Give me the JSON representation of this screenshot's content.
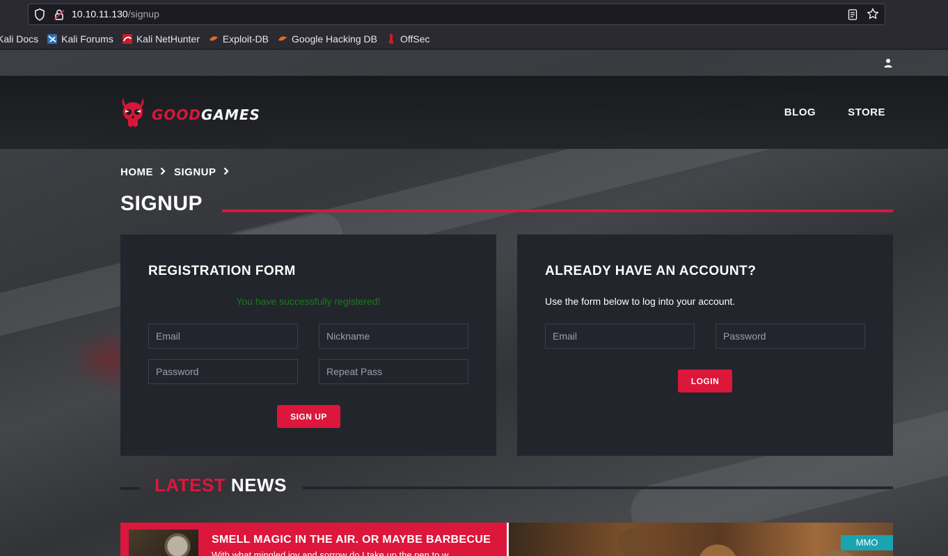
{
  "browser": {
    "url_host": "10.10.11.130",
    "url_path": "/signup",
    "bookmarks": [
      {
        "label": "Kali Docs",
        "icon": "kali-docs-icon",
        "color": "#5a9fd4"
      },
      {
        "label": "Kali Forums",
        "icon": "kali-forums-icon",
        "color": "#5a9fd4"
      },
      {
        "label": "Kali NetHunter",
        "icon": "kali-nethunter-icon",
        "color": "#d0303a"
      },
      {
        "label": "Exploit-DB",
        "icon": "exploit-db-icon",
        "color": "#e06a20"
      },
      {
        "label": "Google Hacking DB",
        "icon": "ghdb-icon",
        "color": "#e06a20"
      },
      {
        "label": "OffSec",
        "icon": "offsec-icon",
        "color": "#d0303a"
      }
    ]
  },
  "site": {
    "logo_part1": "GOOD",
    "logo_part2": "GAMES",
    "nav": [
      "BLOG",
      "STORE"
    ],
    "accent_color": "#dd163b"
  },
  "breadcrumb": [
    "HOME",
    "SIGNUP"
  ],
  "page_title": "SIGNUP",
  "registration": {
    "heading": "REGISTRATION FORM",
    "success_message": "You have successfully registered!",
    "email_placeholder": "Email",
    "nickname_placeholder": "Nickname",
    "password_placeholder": "Password",
    "repeat_placeholder": "Repeat Pass",
    "submit_label": "SIGN UP"
  },
  "login": {
    "heading": "ALREADY HAVE AN ACCOUNT?",
    "lead": "Use the form below to log into your account.",
    "email_placeholder": "Email",
    "password_placeholder": "Password",
    "submit_label": "LOGIN"
  },
  "news": {
    "heading_part1": "LATEST",
    "heading_part2": "NEWS",
    "article_title": "SMELL MAGIC IN THE AIR. OR MAYBE BARBECUE",
    "article_excerpt": "With what mingled joy and sorrow do I take up the pen to w",
    "tag": "MMO"
  }
}
